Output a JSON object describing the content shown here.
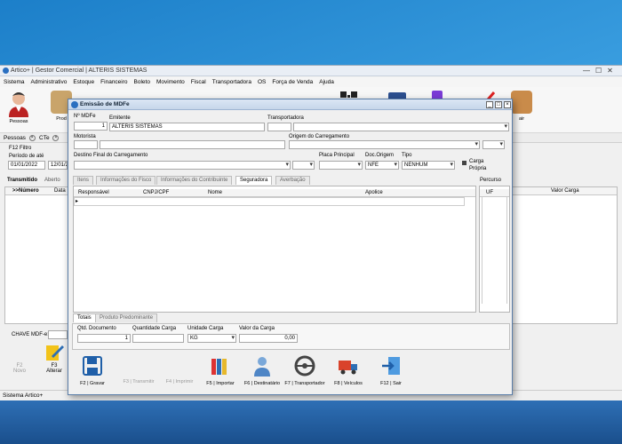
{
  "app": {
    "title": "Artico+ | Gestor Comercial | ALTERIS SISTEMAS",
    "menu": [
      "Sistema",
      "Administrativo",
      "Estoque",
      "Financeiro",
      "Boleto",
      "Movimento",
      "Fiscal",
      "Transportadora",
      "OS",
      "Força de Venda",
      "Ajuda"
    ],
    "toolbar": {
      "pessoas": "Pessoas",
      "produtos": "Prod",
      "sair": "air"
    },
    "tabs": {
      "pessoas": "Pessoas",
      "cte": "CTe"
    },
    "filter": {
      "f12": "F12 Filtro",
      "periodo": "Período de  até",
      "date_from": "01/01/2022",
      "date_to": "12/01/2"
    },
    "grid_tabs": {
      "transmitido": "Transmitido",
      "aberto": "Aberto"
    },
    "grid_headers": {
      "numero": ">>Número",
      "data": "Data",
      "valor_carga": "Valor Carga"
    },
    "chave": "CHAVE MDF-e:",
    "bottom_buttons": {
      "f2": "F2",
      "novo": "Novo",
      "f3": "F3",
      "alterar": "Alterar"
    },
    "status": "Sistema Artico+"
  },
  "dialog": {
    "title": "Emissão de MDFe",
    "labels": {
      "n_mdfe": "Nº MDFe",
      "emitente": "Emitente",
      "transportadora": "Transportadora",
      "motorista": "Motorista",
      "origem": "Origem do Carregamento",
      "destino": "Destino Final do Carregamento",
      "placa": "Placa Principal",
      "doc_origem": "Doc.Origem",
      "tipo": "Tipo",
      "carga_propria": "Carga\nPrópria"
    },
    "values": {
      "n_mdfe": "1",
      "emitente": "ALTERIS SISTEMAS",
      "doc_origem": "NFE",
      "tipo": "NENHUM"
    },
    "tabs": [
      "Itens",
      "Informações do Fisco",
      "Informações do Contribuinte",
      "Seguradora",
      "Averbação"
    ],
    "percurso": "Percurso",
    "percurso_col": "UF",
    "grid_headers": [
      "Responsável",
      "CNPJ/CPF",
      "Nome",
      "Apolice"
    ],
    "bottom_tabs": [
      "Totais",
      "Produto Predominante"
    ],
    "totals": {
      "labels": {
        "qtd": "Qtd. Documento",
        "quantidade": "Quantidade Carga",
        "unidade": "Unidade Carga",
        "valor": "Valor da Carga"
      },
      "values": {
        "qtd": "1",
        "unidade": "KG",
        "valor": "0,00"
      }
    },
    "buttons": {
      "f2": "F2 | Gravar",
      "f3": "F3 | Transmitir",
      "f4": "F4 | Imprimir",
      "f5": "F5 | Importar",
      "f6": "F6 | Destinatário",
      "f7": "F7 | Transportador",
      "f8": "F8 | Veículos",
      "f12": "F12 | Sair"
    }
  }
}
